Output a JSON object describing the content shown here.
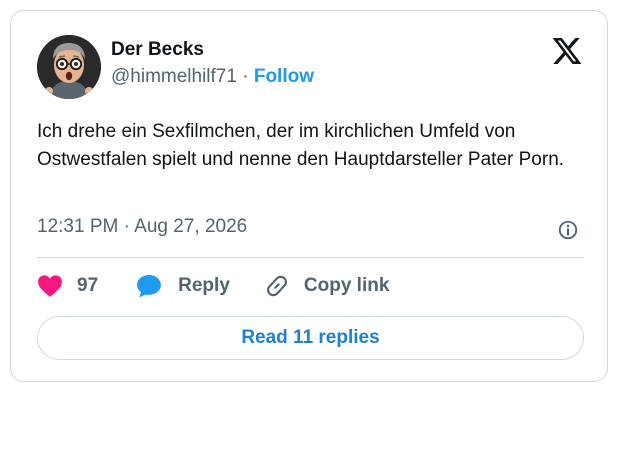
{
  "tweet": {
    "author_name": "Der Becks",
    "handle": "@himmelhilf71",
    "separator": " · ",
    "follow_label": "Follow",
    "text": "Ich drehe ein Sexfilmchen, der im kirchlichen Umfeld von Ostwestfalen spielt und nenne den Hauptdarsteller Pater Porn.",
    "time": "12:31 PM",
    "date": "Aug 27, 2026"
  },
  "actions": {
    "like_count": "97",
    "reply_label": "Reply",
    "copy_label": "Copy link"
  },
  "read_replies_label": "Read 11 replies",
  "icons": {
    "brand": "x-logo-icon",
    "like": "heart-icon",
    "reply": "speech-bubble-icon",
    "copy": "link-icon",
    "info": "info-icon"
  },
  "colors": {
    "like": "#f91880",
    "reply": "#1d9bf0",
    "follow": "#1d9bf0",
    "read_replies": "#1d7fd6",
    "secondary_text": "#536471"
  }
}
